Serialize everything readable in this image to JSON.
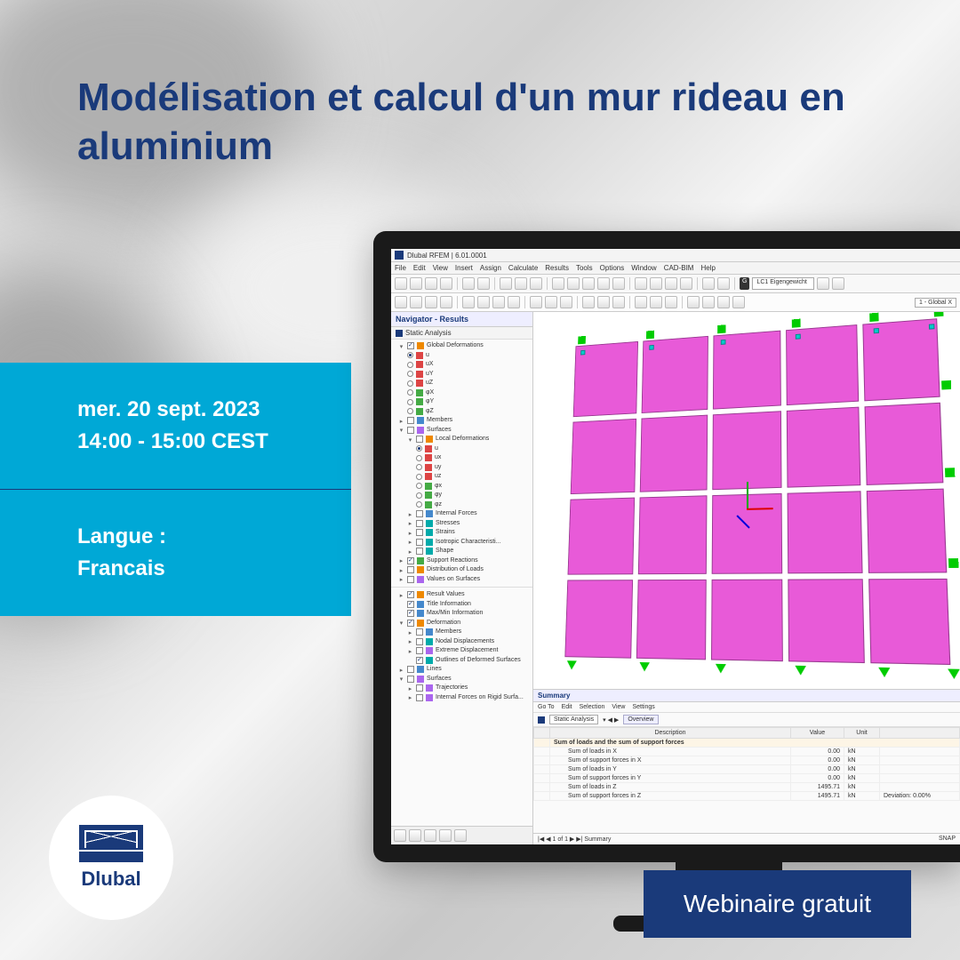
{
  "title": "Modélisation et calcul d'un mur rideau en aluminium",
  "info": {
    "date": "mer. 20 sept. 2023",
    "time": "14:00 - 15:00 CEST",
    "lang_label": "Langue :",
    "lang_value": "Francais"
  },
  "logo": {
    "text": "Dlubal"
  },
  "cta": "Webinaire gratuit",
  "app": {
    "titlebar": "Dlubal RFEM | 6.01.0001",
    "menu": [
      "File",
      "Edit",
      "View",
      "Insert",
      "Assign",
      "Calculate",
      "Results",
      "Tools",
      "Options",
      "Window",
      "CAD-BIM",
      "Help"
    ],
    "lc_badge": "G",
    "lc_combo": "LC1 Eigengewicht",
    "global_combo": "1 - Global X"
  },
  "nav": {
    "header": "Navigator - Results",
    "static": "Static Analysis",
    "tree": {
      "global_def": "Global Deformations",
      "u": "u",
      "ux": "uX",
      "uy": "uY",
      "uz": "uZ",
      "phix": "φX",
      "phiy": "φY",
      "phiz": "φZ",
      "members": "Members",
      "surfaces": "Surfaces",
      "local_def": "Local Deformations",
      "lu": "u",
      "lux": "ux",
      "luy": "uy",
      "luz": "uz",
      "lphix": "φx",
      "lphiy": "φy",
      "lphiz": "φz",
      "int_forces": "Internal Forces",
      "stresses": "Stresses",
      "strains": "Strains",
      "iso": "Isotropic Characteristi...",
      "shape": "Shape",
      "support": "Support Reactions",
      "dist": "Distribution of Loads",
      "vals": "Values on Surfaces",
      "res_vals": "Result Values",
      "title_info": "Title Information",
      "maxmin": "Max/Min Information",
      "deformation": "Deformation",
      "d_members": "Members",
      "nodal": "Nodal Displacements",
      "extreme": "Extreme Displacement",
      "outlines": "Outlines of Deformed Surfaces",
      "lines": "Lines",
      "d_surfaces": "Surfaces",
      "traj": "Trajectories",
      "rigid": "Internal Forces on Rigid Surfa..."
    }
  },
  "summary": {
    "title": "Summary",
    "menu": [
      "Go To",
      "Edit",
      "Selection",
      "View",
      "Settings"
    ],
    "combo": "Static Analysis",
    "overview": "Overview",
    "cols": [
      "",
      "Description",
      "Value",
      "Unit",
      ""
    ],
    "group": "Sum of loads and the sum of support forces",
    "rows": [
      {
        "desc": "Sum of loads in X",
        "val": "0.00",
        "unit": "kN",
        "extra": ""
      },
      {
        "desc": "Sum of support forces in X",
        "val": "0.00",
        "unit": "kN",
        "extra": ""
      },
      {
        "desc": "Sum of loads in Y",
        "val": "0.00",
        "unit": "kN",
        "extra": ""
      },
      {
        "desc": "Sum of support forces in Y",
        "val": "0.00",
        "unit": "kN",
        "extra": ""
      },
      {
        "desc": "Sum of loads in Z",
        "val": "1495.71",
        "unit": "kN",
        "extra": ""
      },
      {
        "desc": "Sum of support forces in Z",
        "val": "1495.71",
        "unit": "kN",
        "extra": "Deviation: 0.00%"
      }
    ],
    "pager_left": "|◀  ◀  1 of 1  ▶  ▶|   Summary",
    "pager_right": "SNAP"
  }
}
